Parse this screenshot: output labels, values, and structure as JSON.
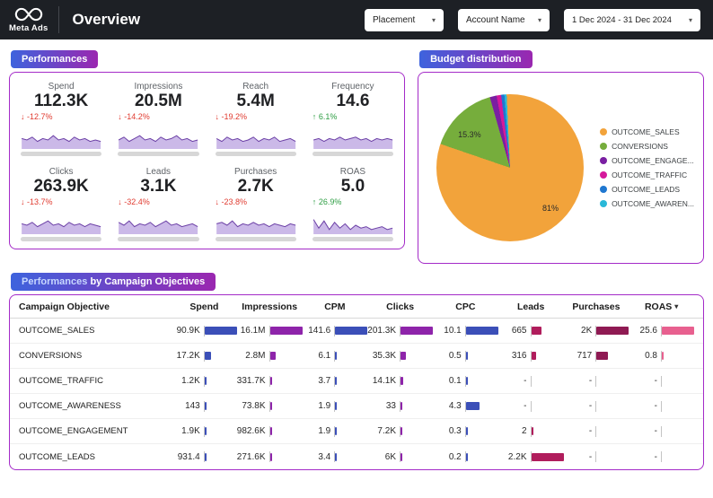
{
  "header": {
    "brand": "Meta Ads",
    "title": "Overview",
    "filters": [
      {
        "label": "Placement"
      },
      {
        "label": "Account Name"
      },
      {
        "label": "1 Dec 2024 - 31 Dec 2024"
      }
    ]
  },
  "icons": {
    "caret": "▾",
    "sort_caret": "▾",
    "arrow_down": "↓",
    "arrow_up": "↑"
  },
  "performances": {
    "badge": "Performances",
    "kpis": [
      {
        "name": "Spend",
        "value": "112.3K",
        "change": "-12.7%",
        "dir": "down",
        "spark": [
          6,
          5,
          7,
          4,
          6,
          5,
          8,
          5,
          6,
          4,
          7,
          5,
          6,
          4,
          5,
          4
        ]
      },
      {
        "name": "Impressions",
        "value": "20.5M",
        "change": "-14.2%",
        "dir": "down",
        "spark": [
          5,
          7,
          4,
          6,
          8,
          5,
          6,
          4,
          7,
          5,
          6,
          8,
          5,
          6,
          4,
          5
        ]
      },
      {
        "name": "Reach",
        "value": "5.4M",
        "change": "-19.2%",
        "dir": "down",
        "spark": [
          6,
          4,
          7,
          5,
          6,
          4,
          5,
          7,
          4,
          6,
          5,
          7,
          4,
          5,
          6,
          4
        ]
      },
      {
        "name": "Frequency",
        "value": "14.6",
        "change": "6.1%",
        "dir": "up",
        "spark": [
          5,
          6,
          4,
          6,
          5,
          7,
          5,
          6,
          7,
          5,
          6,
          4,
          6,
          5,
          6,
          5
        ]
      },
      {
        "name": "Clicks",
        "value": "263.9K",
        "change": "-13.7%",
        "dir": "down",
        "spark": [
          6,
          5,
          7,
          4,
          6,
          8,
          5,
          6,
          4,
          7,
          5,
          6,
          4,
          6,
          5,
          4
        ]
      },
      {
        "name": "Leads",
        "value": "3.1K",
        "change": "-32.4%",
        "dir": "down",
        "spark": [
          7,
          5,
          8,
          4,
          6,
          5,
          7,
          4,
          6,
          8,
          5,
          6,
          4,
          5,
          6,
          4
        ]
      },
      {
        "name": "Purchases",
        "value": "2.7K",
        "change": "-23.8%",
        "dir": "down",
        "spark": [
          6,
          7,
          5,
          8,
          4,
          6,
          5,
          7,
          5,
          6,
          4,
          6,
          5,
          4,
          6,
          5
        ]
      },
      {
        "name": "ROAS",
        "value": "5.0",
        "change": "26.9%",
        "dir": "up",
        "spark": [
          9,
          3,
          8,
          2,
          7,
          3,
          6,
          2,
          5,
          3,
          4,
          2,
          3,
          4,
          2,
          3
        ]
      }
    ]
  },
  "budget": {
    "badge": "Budget distribution"
  },
  "chart_data": [
    {
      "type": "pie",
      "title": "Budget distribution",
      "legend_position": "right",
      "start_angle": -16,
      "slices": [
        {
          "name": "OUTCOME_SALES",
          "pct": 81,
          "color": "#F2A33B",
          "label": "81%"
        },
        {
          "name": "CONVERSIONS",
          "pct": 15.3,
          "color": "#76AD3C",
          "label": "15.3%"
        },
        {
          "name": "OUTCOME_ENGAGE...",
          "pct": 1.5,
          "color": "#7A1FA2",
          "label": ""
        },
        {
          "name": "OUTCOME_TRAFFIC",
          "pct": 1.0,
          "color": "#D5199B",
          "label": ""
        },
        {
          "name": "OUTCOME_LEADS",
          "pct": 0.7,
          "color": "#1F77D0",
          "label": ""
        },
        {
          "name": "OUTCOME_AWAREN...",
          "pct": 0.5,
          "color": "#29B8D8",
          "label": ""
        }
      ],
      "draw_order": [
        2,
        3,
        4,
        5,
        0,
        1
      ]
    }
  ],
  "table": {
    "badge_light": "Performances",
    "badge_bold": "by Campaign Objectives",
    "first_col_header": "Campaign Objective",
    "columns": [
      {
        "label": "Spend",
        "color": "#3B4FB8",
        "sortable": false
      },
      {
        "label": "Impressions",
        "color": "#8E24AA",
        "sortable": false
      },
      {
        "label": "CPM",
        "color": "#3B4FB8",
        "sortable": false
      },
      {
        "label": "Clicks",
        "color": "#8E24AA",
        "sortable": false
      },
      {
        "label": "CPC",
        "color": "#3B4FB8",
        "sortable": false
      },
      {
        "label": "Leads",
        "color": "#B01D5C",
        "sortable": false
      },
      {
        "label": "Purchases",
        "color": "#8F1A53",
        "sortable": false
      },
      {
        "label": "ROAS",
        "color": "#E8608F",
        "sortable": true
      }
    ],
    "rows": [
      {
        "objective": "OUTCOME_SALES",
        "cells": [
          {
            "text": "90.9K",
            "num": 90900
          },
          {
            "text": "16.1M",
            "num": 16100000
          },
          {
            "text": "141.6",
            "num": 141.6
          },
          {
            "text": "201.3K",
            "num": 201300
          },
          {
            "text": "10.1",
            "num": 10.1
          },
          {
            "text": "665",
            "num": 665
          },
          {
            "text": "2K",
            "num": 2000
          },
          {
            "text": "25.6",
            "num": 25.6
          }
        ]
      },
      {
        "objective": "CONVERSIONS",
        "cells": [
          {
            "text": "17.2K",
            "num": 17200
          },
          {
            "text": "2.8M",
            "num": 2800000
          },
          {
            "text": "6.1",
            "num": 6.1
          },
          {
            "text": "35.3K",
            "num": 35300
          },
          {
            "text": "0.5",
            "num": 0.5
          },
          {
            "text": "316",
            "num": 316
          },
          {
            "text": "717",
            "num": 717
          },
          {
            "text": "0.8",
            "num": 0.8
          }
        ]
      },
      {
        "objective": "OUTCOME_TRAFFIC",
        "cells": [
          {
            "text": "1.2K",
            "num": 1200
          },
          {
            "text": "331.7K",
            "num": 331700
          },
          {
            "text": "3.7",
            "num": 3.7
          },
          {
            "text": "14.1K",
            "num": 14100
          },
          {
            "text": "0.1",
            "num": 0.1
          },
          {
            "text": "-",
            "num": null
          },
          {
            "text": "-",
            "num": null
          },
          {
            "text": "-",
            "num": null
          }
        ]
      },
      {
        "objective": "OUTCOME_AWARENESS",
        "cells": [
          {
            "text": "143",
            "num": 143
          },
          {
            "text": "73.8K",
            "num": 73800
          },
          {
            "text": "1.9",
            "num": 1.9
          },
          {
            "text": "33",
            "num": 33
          },
          {
            "text": "4.3",
            "num": 4.3
          },
          {
            "text": "-",
            "num": null
          },
          {
            "text": "-",
            "num": null
          },
          {
            "text": "-",
            "num": null
          }
        ]
      },
      {
        "objective": "OUTCOME_ENGAGEMENT",
        "cells": [
          {
            "text": "1.9K",
            "num": 1900
          },
          {
            "text": "982.6K",
            "num": 982600
          },
          {
            "text": "1.9",
            "num": 1.9
          },
          {
            "text": "7.2K",
            "num": 7200
          },
          {
            "text": "0.3",
            "num": 0.3
          },
          {
            "text": "2",
            "num": 2
          },
          {
            "text": "-",
            "num": null
          },
          {
            "text": "-",
            "num": null
          }
        ]
      },
      {
        "objective": "OUTCOME_LEADS",
        "cells": [
          {
            "text": "931.4",
            "num": 931.4
          },
          {
            "text": "271.6K",
            "num": 271600
          },
          {
            "text": "3.4",
            "num": 3.4
          },
          {
            "text": "6K",
            "num": 6000
          },
          {
            "text": "0.2",
            "num": 0.2
          },
          {
            "text": "2.2K",
            "num": 2200
          },
          {
            "text": "-",
            "num": null
          },
          {
            "text": "-",
            "num": null
          }
        ]
      }
    ]
  }
}
